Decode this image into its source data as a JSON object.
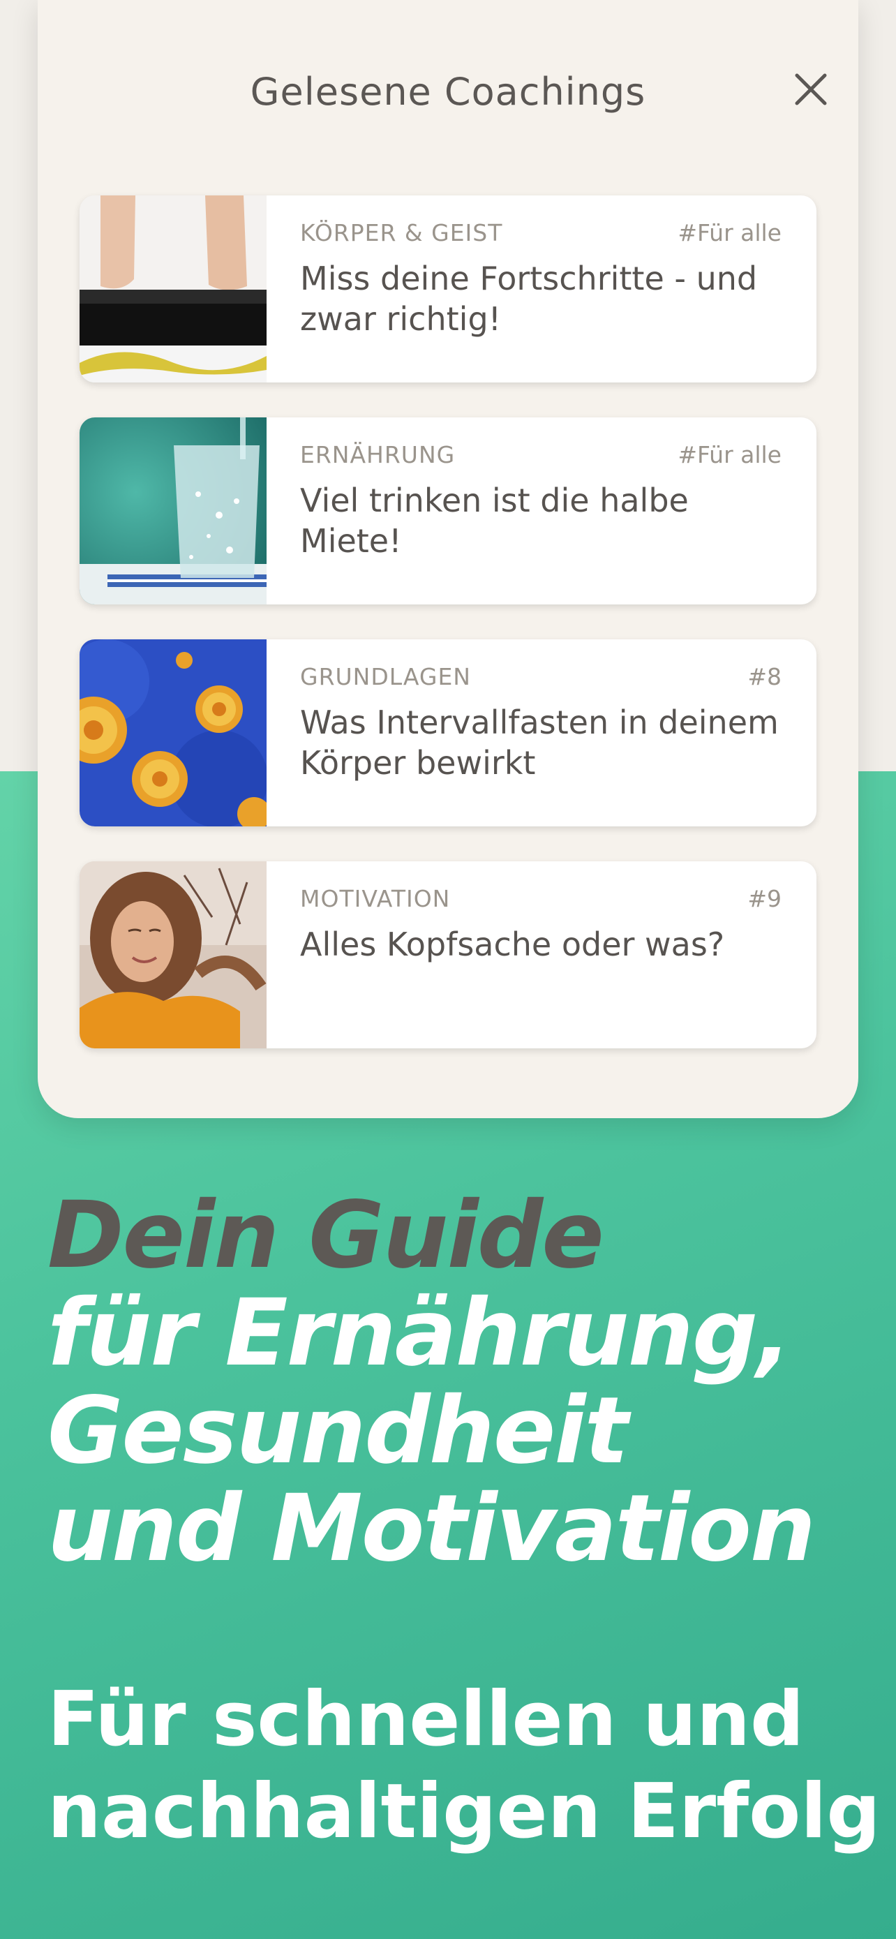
{
  "panel": {
    "title": "Gelesene Coachings",
    "close_icon": "close-icon"
  },
  "cards": [
    {
      "category": "KÖRPER & GEIST",
      "tag": "#Für alle",
      "title": "Miss deine Fortschritte - und zwar richtig!",
      "image": "scale-feet-image"
    },
    {
      "category": "ERNÄHRUNG",
      "tag": "#Für alle",
      "title": "Viel trinken ist die halbe Miete!",
      "image": "water-glass-image"
    },
    {
      "category": "GRUNDLAGEN",
      "tag": "#8",
      "title": "Was Intervallfasten in deinem Körper bewirkt",
      "image": "cells-image"
    },
    {
      "category": "MOTIVATION",
      "tag": "#9",
      "title": "Alles Kopfsache oder was?",
      "image": "woman-portrait-image"
    }
  ],
  "headline": {
    "line1": "Dein Guide",
    "line2": "für Ernährung,",
    "line3": "Gesundheit",
    "line4": "und Motivation"
  },
  "subline": {
    "line1": "Für schnellen und",
    "line2": "nachhaltigen Erfolg"
  },
  "colors": {
    "green_light": "#63d3a8",
    "green_dark": "#35ad8d",
    "panel_bg": "#f6f2ec",
    "headline_dark": "#5d5955"
  }
}
